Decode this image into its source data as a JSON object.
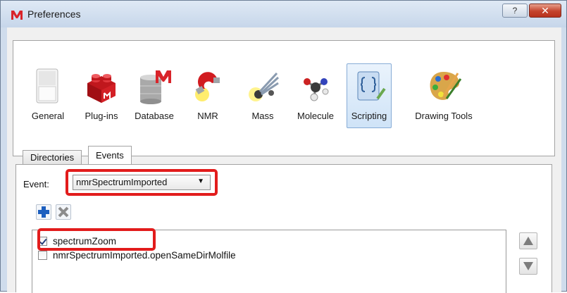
{
  "window": {
    "title": "Preferences",
    "help_label": "?",
    "close_label": "✕"
  },
  "toolbar": {
    "items": [
      {
        "label": "General",
        "icon": "switch-icon"
      },
      {
        "label": "Plug-ins",
        "icon": "lego-brick-icon"
      },
      {
        "label": "Database",
        "icon": "database-icon"
      },
      {
        "label": "NMR",
        "icon": "magnet-icon"
      },
      {
        "label": "Mass",
        "icon": "mass-spec-icon"
      },
      {
        "label": "Molecule",
        "icon": "molecule-icon"
      },
      {
        "label": "Scripting",
        "icon": "scroll-icon",
        "selected": true
      },
      {
        "label": "Drawing Tools",
        "icon": "palette-icon"
      }
    ]
  },
  "tabs": [
    {
      "label": "Directories"
    },
    {
      "label": "Events",
      "active": true
    }
  ],
  "events": {
    "event_label": "Event:",
    "selected_event": "nmrSpectrumImported",
    "scripts": [
      {
        "label": "spectrumZoom",
        "checked": true
      },
      {
        "label": "nmrSpectrumImported.openSameDirMolfile",
        "checked": false
      }
    ]
  },
  "colors": {
    "highlight": "#e21c1c",
    "title_bar": "#cfdcec",
    "selected_tool": "#cfe3f7"
  }
}
